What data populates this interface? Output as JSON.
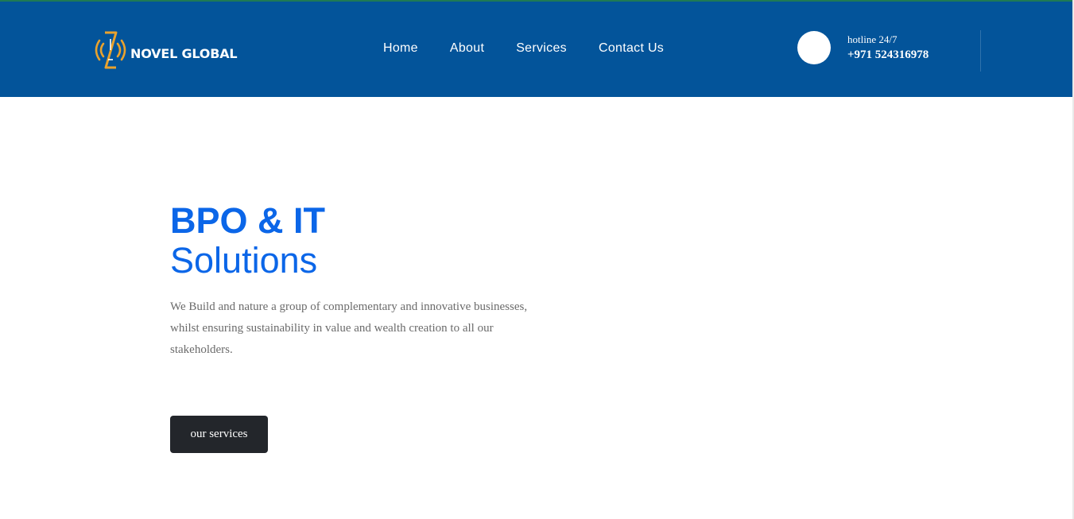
{
  "colors": {
    "header_bg": "#03549a",
    "accent_blue": "#0b66e8",
    "logo_gold": "#e9a22d",
    "button_bg": "#23262b"
  },
  "logo": {
    "icon": "novel-global-logo-icon",
    "text": "NOVEL GLOBAL"
  },
  "nav": {
    "items": [
      {
        "label": "Home"
      },
      {
        "label": "About"
      },
      {
        "label": "Services"
      },
      {
        "label": "Contact Us"
      }
    ]
  },
  "hotline": {
    "icon": "phone-icon",
    "label": "hotline 24/7",
    "number": "+971 524316978"
  },
  "hero": {
    "title_line1": "BPO & IT",
    "title_line2": "Solutions",
    "description": "We Build and nature a group of complementary and innovative businesses, whilst ensuring sustainability in value and wealth creation to all our stakeholders.",
    "cta_label": "our services"
  }
}
